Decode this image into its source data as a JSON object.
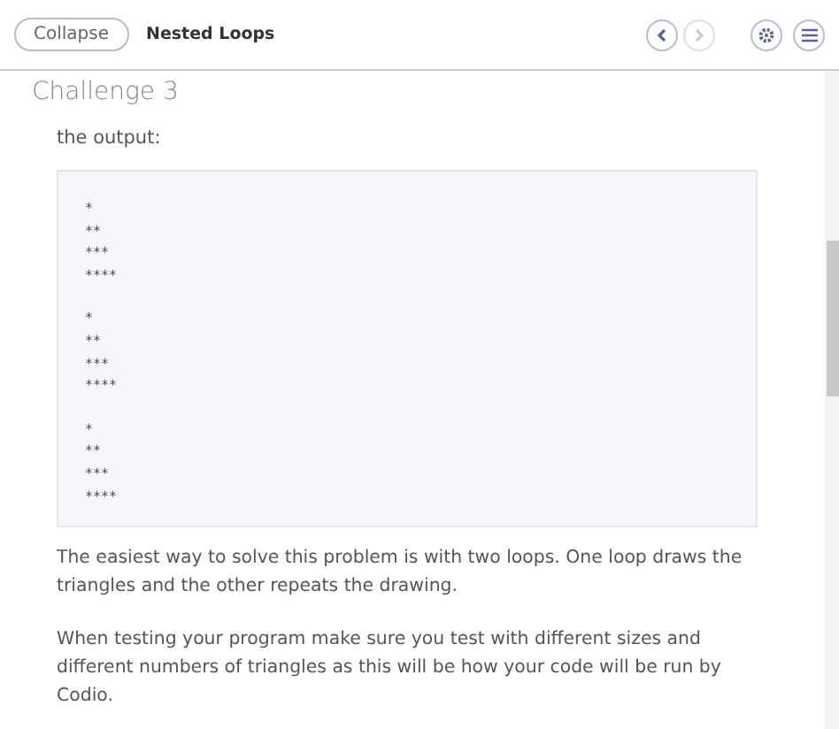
{
  "header": {
    "collapse_button": "Collapse",
    "title": "Nested Loops"
  },
  "content": {
    "heading": "Challenge 3",
    "intro": "the output:",
    "code_groups": [
      "*\n**\n***\n****",
      "*\n**\n***\n****",
      "*\n**\n***\n****"
    ],
    "paragraphs": [
      "The easiest way to solve this problem is with two loops. One loop draws the triangles and the other repeats the drawing.",
      "When testing your program make sure you test with different sizes and different numbers of triangles as this will be how your code will be run by Codio."
    ]
  }
}
